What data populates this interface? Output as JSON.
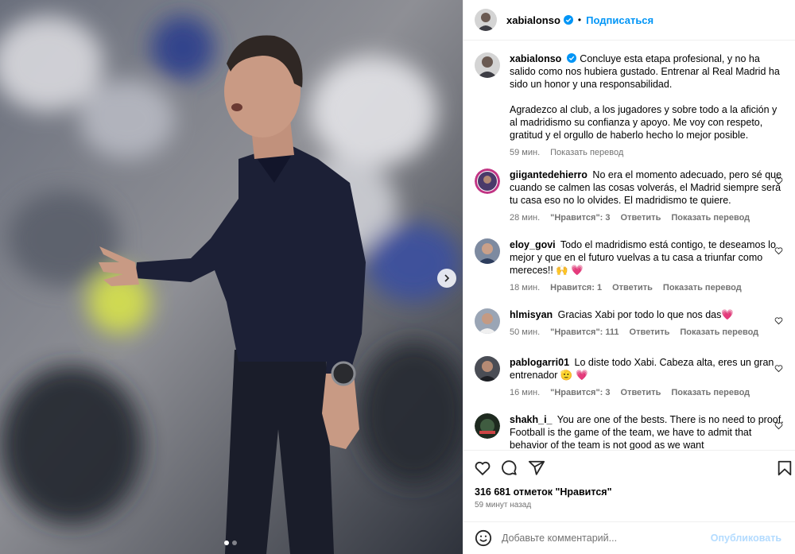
{
  "post": {
    "author": "xabialonso",
    "follow_label": "Подписаться",
    "separator": "•",
    "caption": {
      "p1": "Concluye esta etapa profesional, y no ha salido como nos hubiera gustado. Entrenar al Real Madrid ha sido un honor y una responsabilidad.",
      "p2": "Agradezco al club, a los jugadores y sobre todo a la afición y al madridismo su confianza y apoyo. Me voy con respeto, gratitud y el orgullo de haberlo hecho lo mejor posible.",
      "time": "59 мин.",
      "translate": "Показать перевод"
    }
  },
  "comments": [
    {
      "user": "giigantedehierro",
      "text": "No era el momento adecuado, pero sé que cuando se calmen las cosas volverás, el Madrid siempre será tu casa eso no lo olvides. El madridismo te quiere.",
      "time": "28 мин.",
      "likes": "\"Нравится\": 3",
      "reply": "Ответить",
      "translate": "Показать перевод"
    },
    {
      "user": "eloy_govi",
      "text": "Todo el madridismo está contigo, te deseamos lo mejor y que en el futuro vuelvas a tu casa a triunfar como mereces!! 🙌 💗",
      "time": "18 мин.",
      "likes": "Нравится: 1",
      "reply": "Ответить",
      "translate": "Показать перевод"
    },
    {
      "user": "hlmisyan",
      "text": "Gracias Xabi por todo lo que nos das💗",
      "time": "50 мин.",
      "likes": "\"Нравится\": 111",
      "reply": "Ответить",
      "translate": "Показать перевод"
    },
    {
      "user": "pablogarri01",
      "text": "Lo diste todo Xabi. Cabeza alta, eres un gran entrenador 🫡 💗",
      "time": "16 мин.",
      "likes": "\"Нравится\": 3",
      "reply": "Ответить",
      "translate": "Показать перевод"
    },
    {
      "user": "shakh_i_",
      "text": "You are one of the bests. There is no need to proof. Football is the game of the team, we have to admit that behavior of the team is not good as we want"
    }
  ],
  "stats": {
    "likes": "316 681 отметок \"Нравится\"",
    "posted": "59 минут назад"
  },
  "composer": {
    "placeholder": "Добавьте комментарий...",
    "publish": "Опубликовать"
  },
  "icons": {
    "like": "heart-icon",
    "comment": "comment-icon",
    "share": "share-icon",
    "save": "bookmark-icon",
    "emoji": "emoji-icon",
    "next": "chevron-right-icon",
    "verified": "verified-badge-icon"
  },
  "colors": {
    "accent": "#0095f6",
    "publish_disabled": "#b3dbff",
    "muted": "#737373",
    "verified": "#0095f6"
  },
  "carousel": {
    "slides": 2,
    "current": 1
  }
}
